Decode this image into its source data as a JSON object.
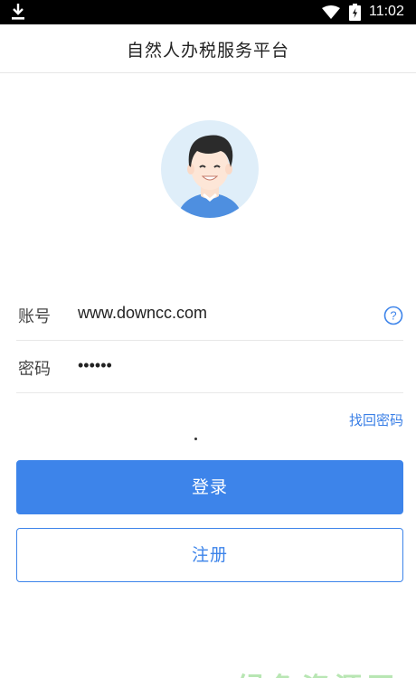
{
  "status_bar": {
    "time": "11:02",
    "icons": [
      "download-icon",
      "wifi-icon",
      "battery-icon"
    ]
  },
  "header": {
    "title": "自然人办税服务平台"
  },
  "form": {
    "account": {
      "label": "账号",
      "value": "www.downcc.com",
      "help_icon": "question-circle-icon"
    },
    "password": {
      "label": "密码",
      "value": "••••••"
    },
    "forgot_label": "找回密码"
  },
  "buttons": {
    "login": "登录",
    "register": "注册"
  },
  "colors": {
    "accent": "#3d84ea",
    "status_bar": "#000000",
    "avatar_bg": "#dfeef9"
  },
  "watermark": "绿色资源网"
}
